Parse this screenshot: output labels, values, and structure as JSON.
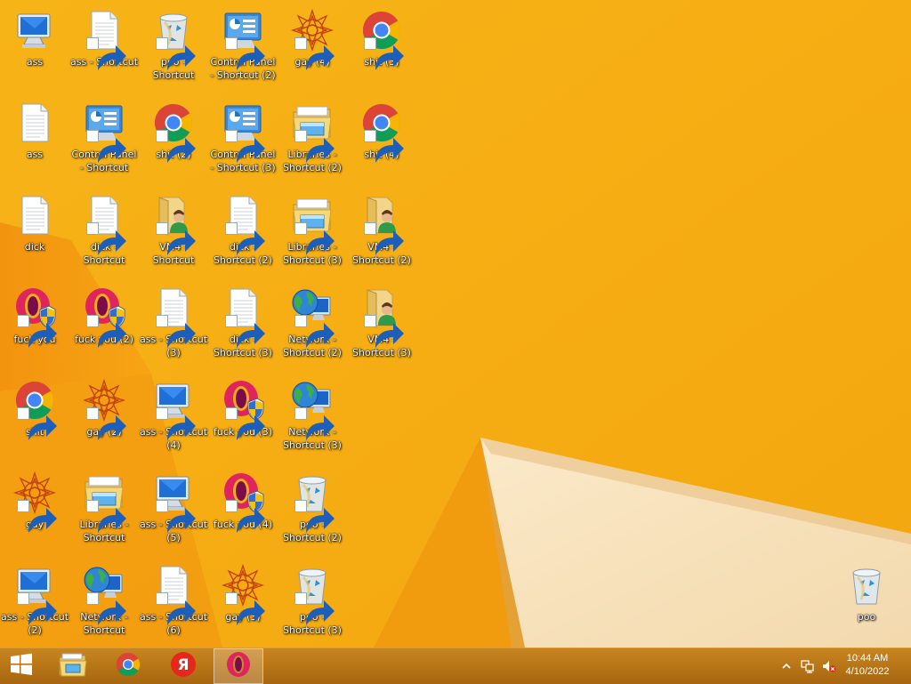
{
  "desktop": {
    "icons": [
      {
        "label": "ass",
        "type": "monitor",
        "shortcut": false,
        "col": 0,
        "row": 0
      },
      {
        "label": "ass - Shortcut",
        "type": "document",
        "shortcut": true,
        "col": 1,
        "row": 0
      },
      {
        "label": "poo - Shortcut",
        "type": "recycle-bin",
        "shortcut": true,
        "col": 2,
        "row": 0
      },
      {
        "label": "Control Panel - Shortcut (2)",
        "type": "control-panel",
        "shortcut": true,
        "col": 3,
        "row": 0
      },
      {
        "label": "gay (4)",
        "type": "mandala",
        "shortcut": true,
        "col": 4,
        "row": 0
      },
      {
        "label": "shit (3)",
        "type": "chrome",
        "shortcut": true,
        "col": 5,
        "row": 0
      },
      {
        "label": "ass",
        "type": "document",
        "shortcut": false,
        "col": 0,
        "row": 1
      },
      {
        "label": "Control Panel - Shortcut",
        "type": "control-panel",
        "shortcut": true,
        "col": 1,
        "row": 1
      },
      {
        "label": "shit (2)",
        "type": "chrome",
        "shortcut": true,
        "col": 2,
        "row": 1
      },
      {
        "label": "Control Panel - Shortcut (3)",
        "type": "control-panel",
        "shortcut": true,
        "col": 3,
        "row": 1
      },
      {
        "label": "Libraries - Shortcut (2)",
        "type": "libraries",
        "shortcut": true,
        "col": 4,
        "row": 1
      },
      {
        "label": "shit (4)",
        "type": "chrome",
        "shortcut": true,
        "col": 5,
        "row": 1
      },
      {
        "label": "dick",
        "type": "document",
        "shortcut": false,
        "col": 0,
        "row": 2
      },
      {
        "label": "dick - Shortcut",
        "type": "document",
        "shortcut": true,
        "col": 1,
        "row": 2
      },
      {
        "label": "VM4 - Shortcut",
        "type": "user-folder",
        "shortcut": true,
        "col": 2,
        "row": 2
      },
      {
        "label": "dick - Shortcut (2)",
        "type": "document",
        "shortcut": true,
        "col": 3,
        "row": 2
      },
      {
        "label": "Libraries - Shortcut (3)",
        "type": "libraries",
        "shortcut": true,
        "col": 4,
        "row": 2
      },
      {
        "label": "VM4 - Shortcut (2)",
        "type": "user-folder",
        "shortcut": true,
        "col": 5,
        "row": 2
      },
      {
        "label": "fuck you",
        "type": "opera-shield",
        "shortcut": true,
        "col": 0,
        "row": 3
      },
      {
        "label": "fuck you (2)",
        "type": "opera-shield",
        "shortcut": true,
        "col": 1,
        "row": 3
      },
      {
        "label": "ass - Shortcut (3)",
        "type": "document",
        "shortcut": true,
        "col": 2,
        "row": 3
      },
      {
        "label": "dick - Shortcut (3)",
        "type": "document",
        "shortcut": true,
        "col": 3,
        "row": 3
      },
      {
        "label": "Network - Shortcut (2)",
        "type": "network",
        "shortcut": true,
        "col": 4,
        "row": 3
      },
      {
        "label": "VM4 - Shortcut (3)",
        "type": "user-folder",
        "shortcut": true,
        "col": 5,
        "row": 3
      },
      {
        "label": "shit",
        "type": "chrome",
        "shortcut": true,
        "col": 0,
        "row": 4
      },
      {
        "label": "gay (2)",
        "type": "mandala",
        "shortcut": true,
        "col": 1,
        "row": 4
      },
      {
        "label": "ass - Shortcut (4)",
        "type": "monitor",
        "shortcut": true,
        "col": 2,
        "row": 4
      },
      {
        "label": "fuck you (3)",
        "type": "opera-shield",
        "shortcut": true,
        "col": 3,
        "row": 4
      },
      {
        "label": "Network - Shortcut (3)",
        "type": "network",
        "shortcut": true,
        "col": 4,
        "row": 4
      },
      {
        "label": "gay",
        "type": "mandala",
        "shortcut": true,
        "col": 0,
        "row": 5
      },
      {
        "label": "Libraries - Shortcut",
        "type": "libraries",
        "shortcut": true,
        "col": 1,
        "row": 5
      },
      {
        "label": "ass - Shortcut (5)",
        "type": "monitor",
        "shortcut": true,
        "col": 2,
        "row": 5
      },
      {
        "label": "fuck you (4)",
        "type": "opera-shield",
        "shortcut": true,
        "col": 3,
        "row": 5
      },
      {
        "label": "poo - Shortcut (2)",
        "type": "recycle-bin",
        "shortcut": true,
        "col": 4,
        "row": 5
      },
      {
        "label": "ass - Shortcut (2)",
        "type": "monitor",
        "shortcut": true,
        "col": 0,
        "row": 6
      },
      {
        "label": "Network - Shortcut",
        "type": "network",
        "shortcut": true,
        "col": 1,
        "row": 6
      },
      {
        "label": "ass - Shortcut (6)",
        "type": "document",
        "shortcut": true,
        "col": 2,
        "row": 6
      },
      {
        "label": "gay (3)",
        "type": "mandala",
        "shortcut": true,
        "col": 3,
        "row": 6
      },
      {
        "label": "poo - Shortcut (3)",
        "type": "recycle-bin",
        "shortcut": true,
        "col": 4,
        "row": 6
      }
    ],
    "recycle_bin": {
      "label": "poo",
      "type": "recycle-bin"
    }
  },
  "taskbar": {
    "start_icon": "windows-start-icon",
    "pinned": [
      {
        "name": "file-explorer",
        "icon": "folder-icon",
        "active": false
      },
      {
        "name": "chrome",
        "icon": "chrome-icon",
        "active": false
      },
      {
        "name": "yandex",
        "icon": "yandex-icon",
        "active": false,
        "glyph": "Я"
      },
      {
        "name": "opera",
        "icon": "opera-icon",
        "active": true
      }
    ],
    "tray": {
      "icons": [
        "show-hidden-icons-chevron",
        "network-icon",
        "volume-muted-icon"
      ]
    },
    "clock": {
      "time": "10:44 AM",
      "date": "4/10/2022"
    }
  },
  "colors": {
    "wallpaper": "#f6ac14",
    "taskbar": "#b06e18"
  }
}
